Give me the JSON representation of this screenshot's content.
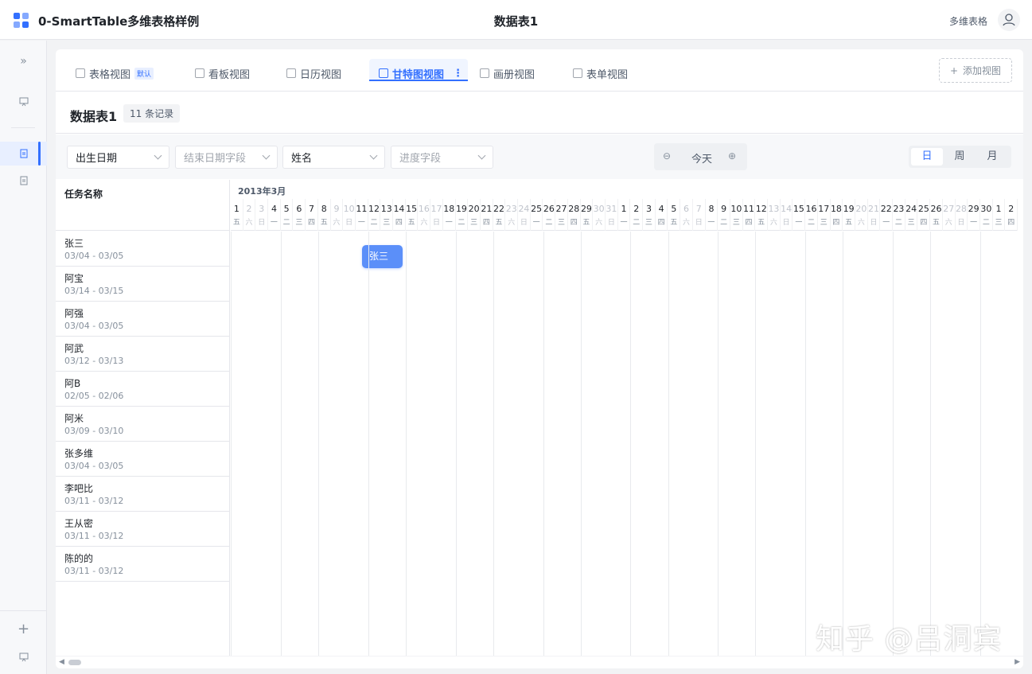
{
  "app": {
    "title": "0-SmartTable多维表格样例",
    "center_title": "数据表1",
    "right_label": "多维表格"
  },
  "sidebar": {
    "expand_glyph": "»",
    "add_glyph": "+"
  },
  "tabs": [
    {
      "label": "表格视图",
      "badge": "默认",
      "icon": "grid-icon"
    },
    {
      "label": "看板视图",
      "icon": "kanban-icon"
    },
    {
      "label": "日历视图",
      "icon": "calendar-icon"
    },
    {
      "label": "甘特图视图",
      "icon": "gantt-icon",
      "active": true
    },
    {
      "label": "画册视图",
      "icon": "gallery-icon"
    },
    {
      "label": "表单视图",
      "icon": "form-icon"
    }
  ],
  "add_view": {
    "label": "添加视图",
    "glyph": "+"
  },
  "table": {
    "title": "数据表1",
    "record_count": "11 条记录"
  },
  "filters": {
    "start_field": "出生日期",
    "end_field_placeholder": "结束日期字段",
    "name_field": "姓名",
    "progress_placeholder": "进度字段"
  },
  "zoom": {
    "today": "今天",
    "zoom_out_glyph": "⊖",
    "zoom_in_glyph": "⊕"
  },
  "scale": {
    "day": "日",
    "week": "周",
    "month": "月",
    "selected": "day"
  },
  "task_header": "任务名称",
  "tasks": [
    {
      "name": "张三",
      "range": "03/04 - 03/05"
    },
    {
      "name": "阿宝",
      "range": "03/14 - 03/15"
    },
    {
      "name": "阿强",
      "range": "03/04 - 03/05"
    },
    {
      "name": "阿武",
      "range": "03/12 - 03/13"
    },
    {
      "name": "阿B",
      "range": "02/05 - 02/06"
    },
    {
      "name": "阿米",
      "range": "03/09 - 03/10"
    },
    {
      "name": "张多维",
      "range": "03/04 - 03/05"
    },
    {
      "name": "李吧比",
      "range": "03/11 - 03/12"
    },
    {
      "name": "王从密",
      "range": "03/11 - 03/12"
    },
    {
      "name": "陈的的",
      "range": "03/11 - 03/12"
    }
  ],
  "gantt": {
    "month_label": "2013年3月",
    "days": [
      {
        "n": "1",
        "w": "五"
      },
      {
        "n": "2",
        "w": "六",
        "we": true
      },
      {
        "n": "3",
        "w": "日",
        "we": true
      },
      {
        "n": "4",
        "w": "一"
      },
      {
        "n": "5",
        "w": "二"
      },
      {
        "n": "6",
        "w": "三"
      },
      {
        "n": "7",
        "w": "四"
      },
      {
        "n": "8",
        "w": "五"
      },
      {
        "n": "9",
        "w": "六",
        "we": true
      },
      {
        "n": "10",
        "w": "日",
        "we": true
      },
      {
        "n": "11",
        "w": "一"
      },
      {
        "n": "12",
        "w": "二"
      },
      {
        "n": "13",
        "w": "三"
      },
      {
        "n": "14",
        "w": "四"
      },
      {
        "n": "15",
        "w": "五"
      },
      {
        "n": "16",
        "w": "六",
        "we": true
      },
      {
        "n": "17",
        "w": "日",
        "we": true
      },
      {
        "n": "18",
        "w": "一"
      },
      {
        "n": "19",
        "w": "二"
      },
      {
        "n": "20",
        "w": "三"
      },
      {
        "n": "21",
        "w": "四"
      },
      {
        "n": "22",
        "w": "五"
      },
      {
        "n": "23",
        "w": "六",
        "we": true
      },
      {
        "n": "24",
        "w": "日",
        "we": true
      },
      {
        "n": "25",
        "w": "一"
      },
      {
        "n": "26",
        "w": "二"
      },
      {
        "n": "27",
        "w": "三"
      },
      {
        "n": "28",
        "w": "四"
      },
      {
        "n": "29",
        "w": "五"
      },
      {
        "n": "30",
        "w": "六",
        "we": true
      },
      {
        "n": "31",
        "w": "日",
        "we": true
      },
      {
        "n": "1",
        "w": "一"
      },
      {
        "n": "2",
        "w": "二"
      },
      {
        "n": "3",
        "w": "三"
      },
      {
        "n": "4",
        "w": "四"
      },
      {
        "n": "5",
        "w": "五"
      },
      {
        "n": "6",
        "w": "六",
        "we": true
      },
      {
        "n": "7",
        "w": "日",
        "we": true
      },
      {
        "n": "8",
        "w": "一"
      },
      {
        "n": "9",
        "w": "二"
      },
      {
        "n": "10",
        "w": "三"
      },
      {
        "n": "11",
        "w": "四"
      },
      {
        "n": "12",
        "w": "五"
      },
      {
        "n": "13",
        "w": "六",
        "we": true
      },
      {
        "n": "14",
        "w": "日",
        "we": true
      },
      {
        "n": "15",
        "w": "一"
      },
      {
        "n": "16",
        "w": "二"
      },
      {
        "n": "17",
        "w": "三"
      },
      {
        "n": "18",
        "w": "四"
      },
      {
        "n": "19",
        "w": "五"
      },
      {
        "n": "20",
        "w": "六",
        "we": true
      },
      {
        "n": "21",
        "w": "日",
        "we": true
      },
      {
        "n": "22",
        "w": "一"
      },
      {
        "n": "23",
        "w": "二"
      },
      {
        "n": "24",
        "w": "三"
      },
      {
        "n": "25",
        "w": "四"
      },
      {
        "n": "26",
        "w": "五"
      },
      {
        "n": "27",
        "w": "六",
        "we": true
      },
      {
        "n": "28",
        "w": "日",
        "we": true
      },
      {
        "n": "29",
        "w": "一"
      },
      {
        "n": "30",
        "w": "二"
      },
      {
        "n": "1",
        "w": "三"
      },
      {
        "n": "2",
        "w": "四"
      }
    ],
    "bar": {
      "label": "张三"
    }
  },
  "scrollbar": {
    "left_glyph": "◀",
    "right_glyph": "▶"
  },
  "watermark": "知乎 @吕洞宾",
  "colors": {
    "accent": "#3370ff",
    "bar": "#5b8ff9"
  }
}
